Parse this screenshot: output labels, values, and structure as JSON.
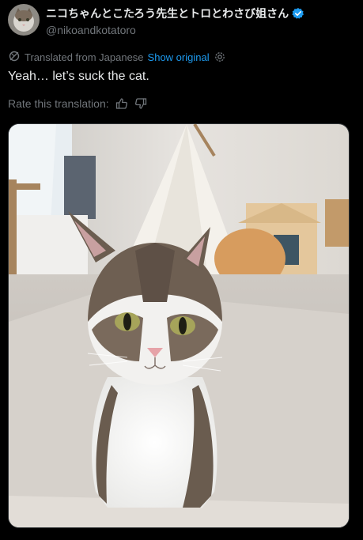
{
  "author": {
    "display_name": "ニコちゃんとこたろう先生とトロとわさび姐さん",
    "handle": "@nikoandkotatoro",
    "verified": true
  },
  "translation": {
    "label": "Translated from Japanese",
    "show_original": "Show original"
  },
  "tweet": {
    "text": "Yeah… let’s suck the cat."
  },
  "rating": {
    "label": "Rate this translation:"
  },
  "icons": {
    "translate": "translate-icon",
    "settings": "gear-icon",
    "thumbs_up": "thumbs-up-icon",
    "thumbs_down": "thumbs-down-icon",
    "verified": "verified-badge-icon"
  },
  "colors": {
    "background": "#000000",
    "text": "#e7e9ea",
    "secondary": "#71767b",
    "link": "#1d9bf0"
  }
}
